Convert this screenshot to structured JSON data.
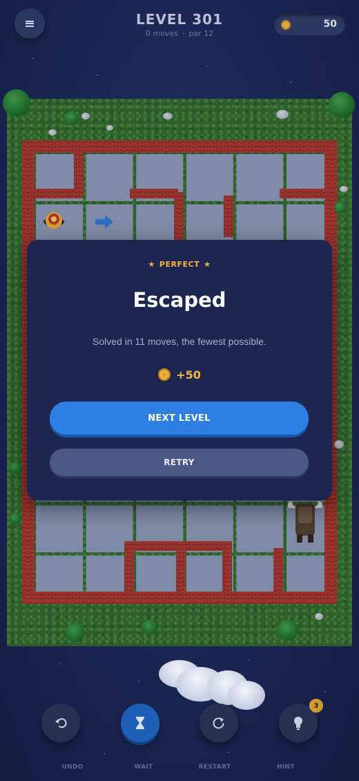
{
  "header": {
    "menu_icon": "hamburger-menu-icon",
    "level_title": "LEVEL 301",
    "moves_text": "0 moves",
    "separator": "·",
    "par_text": "par 12",
    "coin_balance": "50",
    "coin_icon": "coin-icon"
  },
  "board": {
    "grass_color": "#2f5f2c",
    "wall_color": "#9c3530",
    "floor_color": "#7e8aa6",
    "player_icon": "explorer-character-icon",
    "move_arrow_icon": "arrow-right-icon",
    "enemy_icon": "minotaur-icon"
  },
  "dialog": {
    "rating": "PERFECT",
    "star": "★",
    "title": "Escaped",
    "message": "Solved in 11 moves, the fewest possible.",
    "reward": "+50",
    "next_button": "NEXT LEVEL",
    "retry_button": "RETRY"
  },
  "toolbar": {
    "undo_label": "UNDO",
    "wait_label": "WAIT",
    "restart_label": "RESTART",
    "hint_label": "HINT",
    "hint_count": "3",
    "active_tool": "wait",
    "icons": [
      "undo-icon",
      "hourglass-icon",
      "restart-icon",
      "lightbulb-icon"
    ]
  },
  "colors": {
    "primary_button": "#2e7fe2",
    "secondary_button": "#4c5784",
    "accent_gold": "#f5b63d",
    "background": "#1b2652"
  }
}
